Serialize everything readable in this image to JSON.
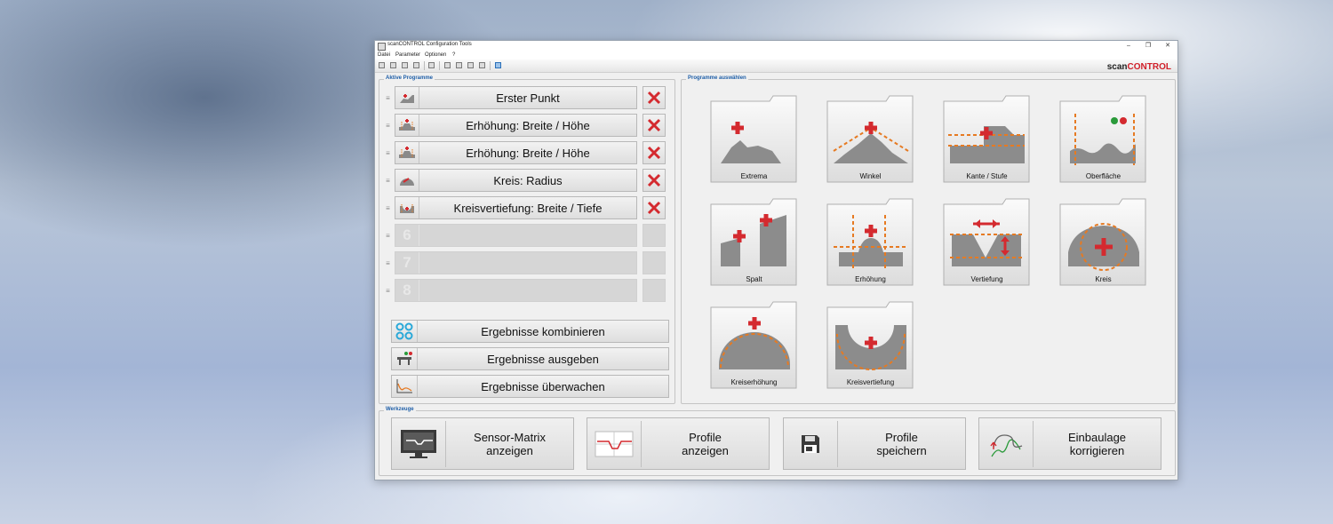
{
  "window": {
    "title": "scanCONTROL Configuration Tools",
    "brand_prefix": "scan",
    "brand_suffix": "CONTROL",
    "controls": {
      "minimize": "–",
      "restore": "❐",
      "close": "✕"
    }
  },
  "menu": [
    "Datei",
    "Parameter",
    "Optionen",
    "?"
  ],
  "active_programs": {
    "title": "Aktive Programme",
    "items": [
      {
        "label": "Erster Punkt",
        "icon": "extrema-icon"
      },
      {
        "label": "Erhöhung: Breite / Höhe",
        "icon": "elevation-icon"
      },
      {
        "label": "Erhöhung: Breite / Höhe",
        "icon": "elevation-icon"
      },
      {
        "label": "Kreis: Radius",
        "icon": "circle-icon"
      },
      {
        "label": "Kreisvertiefung: Breite / Tiefe",
        "icon": "circle-depression-icon"
      }
    ],
    "empty_slots": [
      "6",
      "7",
      "8"
    ],
    "result_buttons": [
      {
        "label": "Ergebnisse kombinieren",
        "icon": "combine-icon"
      },
      {
        "label": "Ergebnisse ausgeben",
        "icon": "output-icon"
      },
      {
        "label": "Ergebnisse überwachen",
        "icon": "monitor-chart-icon"
      }
    ]
  },
  "program_select": {
    "title": "Programme auswählen",
    "folders": [
      "Extrema",
      "Winkel",
      "Kante / Stufe",
      "Oberfläche",
      "Spalt",
      "Erhöhung",
      "Vertiefung",
      "Kreis",
      "Kreiserhöhung",
      "Kreisvertiefung"
    ]
  },
  "tools": {
    "title": "Werkzeuge",
    "buttons": [
      {
        "line1": "Sensor-Matrix",
        "line2": "anzeigen",
        "icon": "monitor-icon"
      },
      {
        "line1": "Profile",
        "line2": "anzeigen",
        "icon": "profile-chart-icon"
      },
      {
        "line1": "Profile",
        "line2": "speichern",
        "icon": "floppy-disk-icon"
      },
      {
        "line1": "Einbaulage",
        "line2": "korrigieren",
        "icon": "alignment-icon"
      }
    ]
  },
  "colors": {
    "accent_red": "#d42a2f",
    "group_title_blue": "#1f5fa8",
    "orange_dash": "#e67a22"
  }
}
